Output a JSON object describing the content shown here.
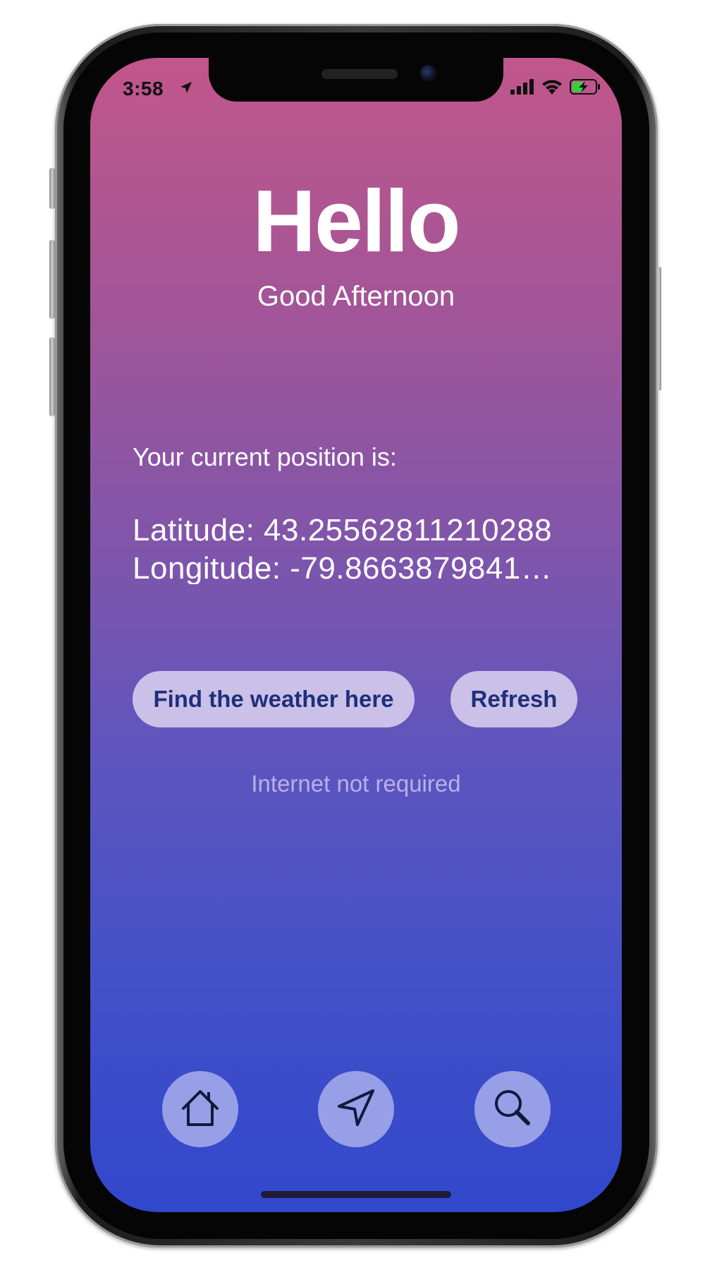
{
  "status_bar": {
    "time": "3:58",
    "location_icon": "location-arrow-icon",
    "signal_icon": "cellular-signal-icon",
    "wifi_icon": "wifi-icon",
    "battery_icon": "battery-charging-icon"
  },
  "header": {
    "title": "Hello",
    "greeting": "Good Afternoon"
  },
  "position": {
    "label": "Your current position is:",
    "latitude": "Latitude: 43.25562811210288",
    "longitude": "Longitude: -79.8663879841…"
  },
  "actions": {
    "find_weather_label": "Find the weather here",
    "refresh_label": "Refresh"
  },
  "hint": "Internet not required",
  "tab_bar": {
    "items": [
      {
        "icon": "home-icon"
      },
      {
        "icon": "navigation-arrow-icon"
      },
      {
        "icon": "search-icon"
      }
    ]
  },
  "colors": {
    "gradient_top": "#c1568a",
    "gradient_bottom": "#3147cc",
    "pill_bg": "#cbc0e8",
    "pill_text": "#1f2f7a",
    "nav_button_bg": "#97a0e6",
    "hint_text": "#b9b0ea",
    "battery_fill": "#38d13c"
  }
}
